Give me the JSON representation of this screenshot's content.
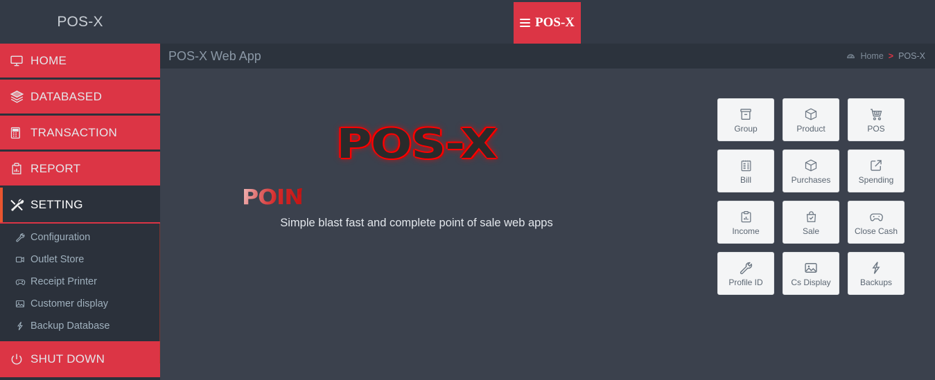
{
  "header": {
    "brand": "POS-X",
    "menu_button_label": "POS-X",
    "menu_icon": "hamburger-icon"
  },
  "page": {
    "title": "POS-X Web App",
    "breadcrumb": {
      "home_icon": "dashboard-icon",
      "home": "Home",
      "separator": ">",
      "current": "POS-X"
    }
  },
  "sidebar": {
    "items": [
      {
        "label": "HOME",
        "icon": "monitor-icon",
        "active": false
      },
      {
        "label": "DATABASED",
        "icon": "layers-icon",
        "active": false
      },
      {
        "label": "TRANSACTION",
        "icon": "calculator-icon",
        "active": false
      },
      {
        "label": "REPORT",
        "icon": "report-chart-icon",
        "active": false
      },
      {
        "label": "SETTING",
        "icon": "tools-icon",
        "active": true
      }
    ],
    "submenu": [
      {
        "label": "Configuration",
        "icon": "wrench-icon"
      },
      {
        "label": "Outlet Store",
        "icon": "display-icon"
      },
      {
        "label": "Receipt Printer",
        "icon": "gamepad-icon"
      },
      {
        "label": "Customer display",
        "icon": "image-icon"
      },
      {
        "label": "Backup Database",
        "icon": "bolt-icon"
      }
    ],
    "shutdown": {
      "label": "SHUT DOWN",
      "icon": "power-icon"
    }
  },
  "main": {
    "logo_text": "POS-X",
    "sub_logo_text": "POIN",
    "tagline": "Simple blast fast and complete point of sale web apps",
    "tiles": [
      {
        "label": "Group",
        "icon": "archive-box-icon"
      },
      {
        "label": "Product",
        "icon": "package-icon"
      },
      {
        "label": "POS",
        "icon": "cart-plus-icon"
      },
      {
        "label": "Bill",
        "icon": "notebook-icon"
      },
      {
        "label": "Purchases",
        "icon": "package-icon"
      },
      {
        "label": "Spending",
        "icon": "external-link-icon"
      },
      {
        "label": "Income",
        "icon": "clipboard-chart-icon"
      },
      {
        "label": "Sale",
        "icon": "bag-check-icon"
      },
      {
        "label": "Close Cash",
        "icon": "gamepad-icon"
      },
      {
        "label": "Profile ID",
        "icon": "wrench-icon"
      },
      {
        "label": "Cs Display",
        "icon": "image-icon"
      },
      {
        "label": "Backups",
        "icon": "bolt-icon"
      }
    ]
  },
  "colors": {
    "accent_red": "#dc3545",
    "sidebar_dark": "#2b313b",
    "content_bg": "#3b414d",
    "topbar": "#333a46",
    "active_bar": "#e8552f"
  }
}
